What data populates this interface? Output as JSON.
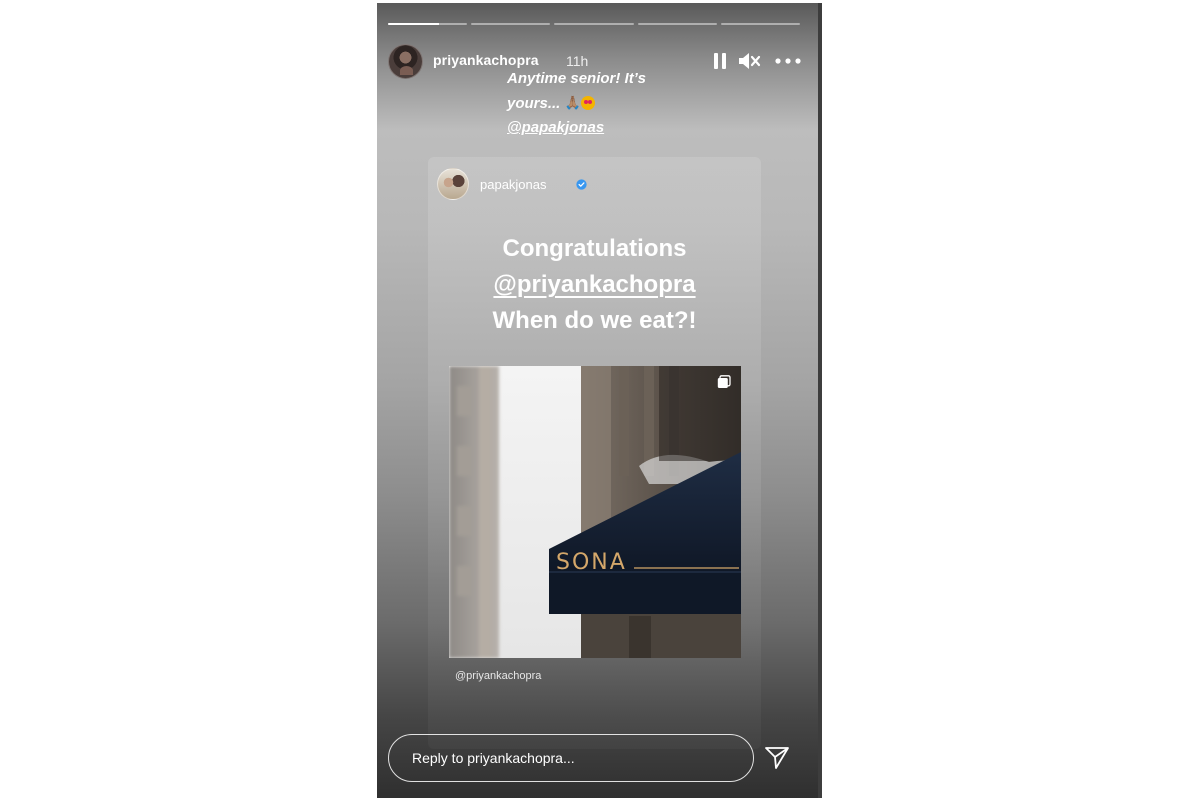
{
  "story": {
    "progress_segments": [
      {
        "state": "active",
        "progress": 0.64
      },
      {
        "state": "pending",
        "progress": 0
      },
      {
        "state": "pending",
        "progress": 0
      },
      {
        "state": "pending",
        "progress": 0
      },
      {
        "state": "pending",
        "progress": 0
      }
    ],
    "username": "priyankachopra",
    "time_ago": "11h",
    "controls": {
      "pause_icon": "pause-icon",
      "mute_icon": "speaker-muted-icon",
      "more_icon": "more-options-icon"
    },
    "caption": {
      "line1": "Anytime senior! It’s",
      "line2_text": "yours...",
      "line2_emojis": [
        "🙏🏽",
        "😍"
      ],
      "mention": "@papakjonas"
    }
  },
  "reshared_post": {
    "username": "papakjonas",
    "verified": true,
    "text_line1": "Congratulations",
    "text_mention": "@priyankachopra",
    "text_line3": "When do we eat?!",
    "image_sign_text": "SONA",
    "image_caption": "@priyankachopra",
    "multi_image_icon": "multiple-images-icon"
  },
  "reply": {
    "placeholder": "Reply to priyankachopra..."
  },
  "colors": {
    "verified_blue": "#3897f0",
    "awning_dark": "#142033",
    "sign_gold": "#d4a76a"
  }
}
